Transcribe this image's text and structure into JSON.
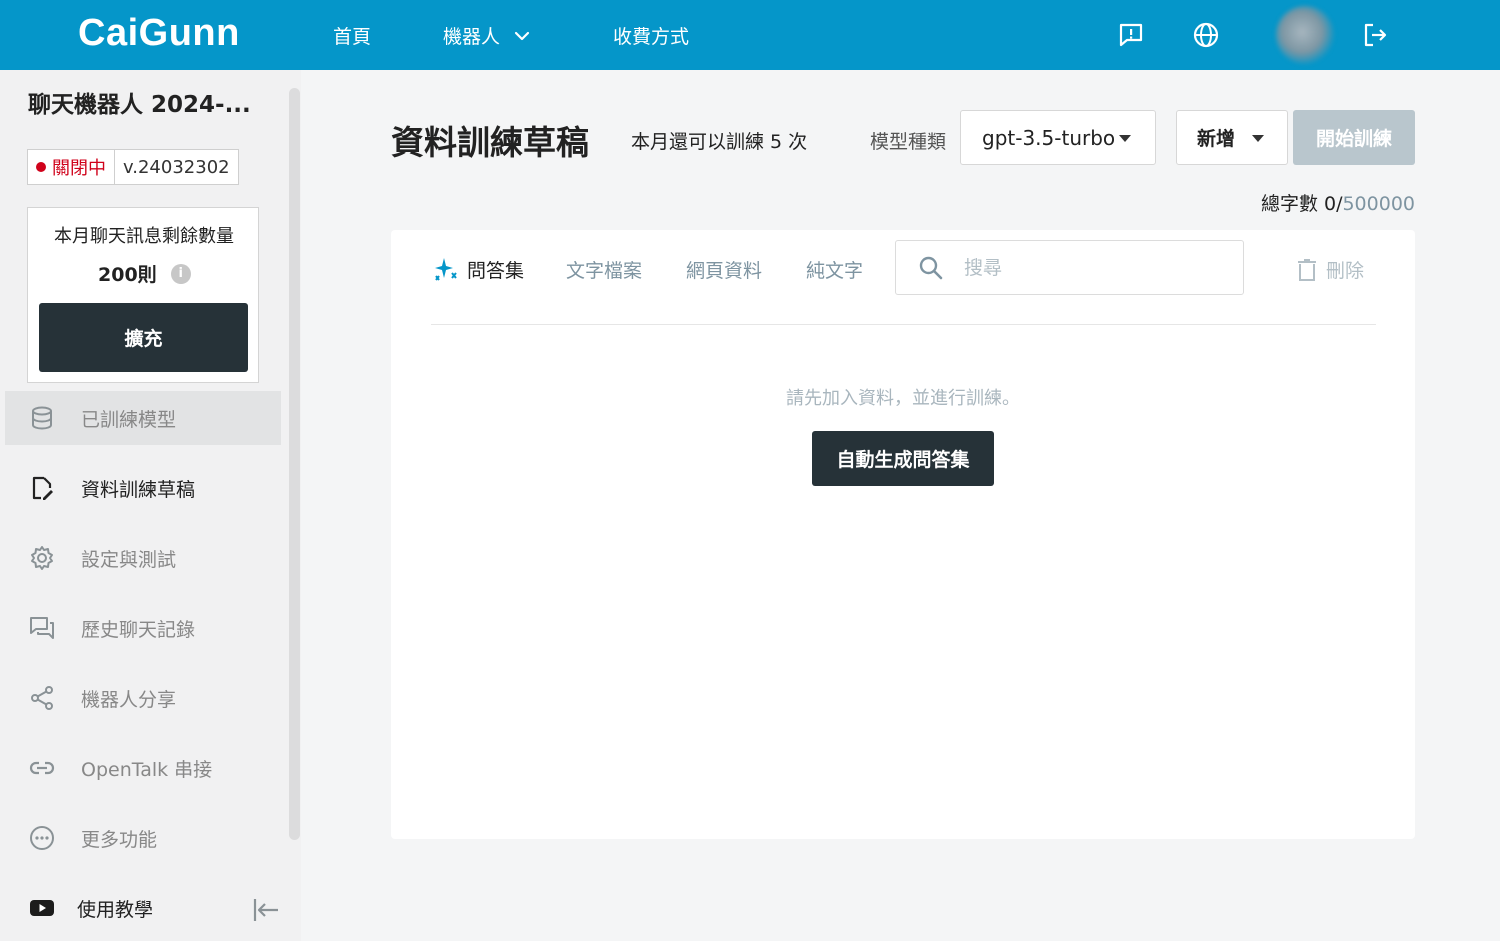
{
  "header": {
    "logo": "CaiGunn",
    "nav": {
      "home": "首頁",
      "bots": "機器人",
      "pricing": "收費方式"
    },
    "icons": [
      "feedback-icon",
      "globe-icon",
      "avatar",
      "logout-icon"
    ],
    "brand_color": "#0596c9"
  },
  "sidebar": {
    "bot_name": "聊天機器人 2024-...",
    "status": "關閉中",
    "version": "v.24032302",
    "quota_title": "本月聊天訊息剩餘數量",
    "quota_value": "200則",
    "info_icon": "i",
    "expand_label": "擴充",
    "items": [
      {
        "label": "已訓練模型",
        "icon": "database-icon"
      },
      {
        "label": "資料訓練草稿",
        "icon": "edit-document-icon"
      },
      {
        "label": "設定與測試",
        "icon": "gear-icon"
      },
      {
        "label": "歷史聊天記錄",
        "icon": "chat-history-icon"
      },
      {
        "label": "機器人分享",
        "icon": "share-icon"
      },
      {
        "label": "OpenTalk 串接",
        "icon": "link-icon"
      },
      {
        "label": "更多功能",
        "icon": "more-icon"
      },
      {
        "label": "使用教學",
        "icon": "youtube-icon"
      }
    ]
  },
  "main": {
    "title": "資料訓練草稿",
    "train_quota": "本月還可以訓練 5 次",
    "model_label": "模型種類",
    "model_value": "gpt-3.5-turbo",
    "add_label": "新增",
    "train_label": "開始訓練",
    "word_count_label": "總字數 0/",
    "word_count_max": "500000",
    "tabs": [
      "問答集",
      "文字檔案",
      "網頁資料",
      "純文字"
    ],
    "search_placeholder": "搜尋",
    "delete_label": "刪除",
    "empty_message": "請先加入資料，並進行訓練。",
    "generate_label": "自動生成問答集"
  }
}
